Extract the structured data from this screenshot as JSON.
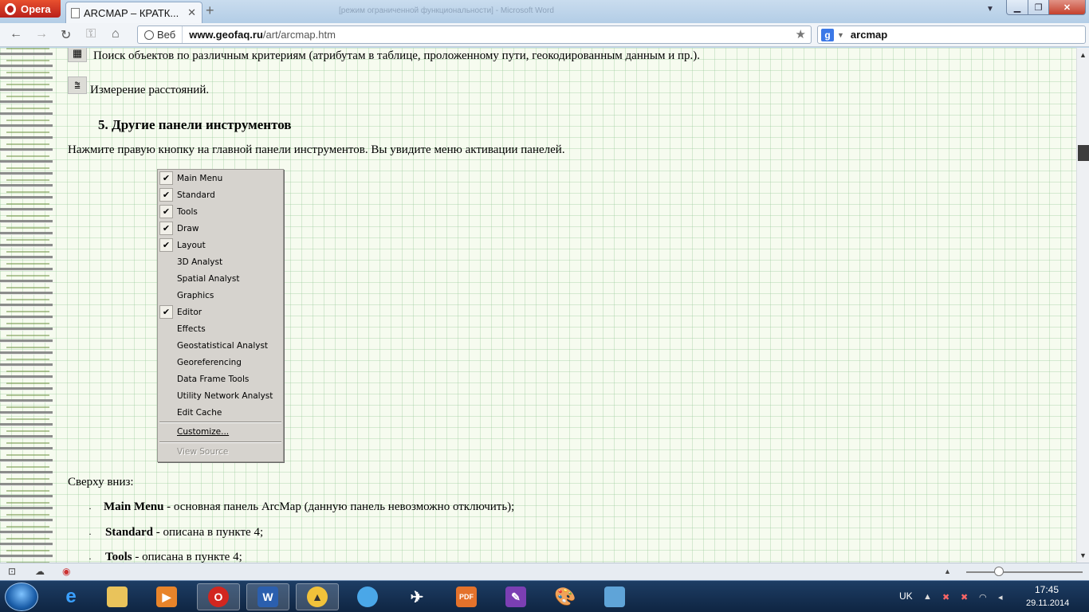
{
  "browser": {
    "opera_label": "Opera",
    "tab_title": "ARCMAP – КРАТК...",
    "blurred_window_title": "[режим ограниченной функциональности] - Microsoft Word",
    "address_badge": "Веб",
    "url_domain": "www.geofaq.ru",
    "url_path": "/art/arcmap.htm",
    "search_value": "arcmap"
  },
  "content": {
    "search_objects_text": "Поиск объектов по различным критериям (атрибутам в таблице, проложенному пути, геокодированным данным и пр.).",
    "measure_text": "Измерение расстояний.",
    "section_heading": "5. Другие панели инструментов",
    "intro_text": "Нажмите правую кнопку на главной панели инструментов. Вы увидите меню активации панелей.",
    "top_down_label": "Сверху вниз:",
    "bullets": [
      {
        "bold": "Main Menu",
        "rest": " - основная панель ArcMap (данную панель невозможно отключить);"
      },
      {
        "bold": "Standard",
        "rest": " - описана в пункте 4;"
      },
      {
        "bold": "Tools",
        "rest": " - описана в пункте 4;"
      }
    ]
  },
  "menu": {
    "items": [
      {
        "label": "Main Menu",
        "checked": true
      },
      {
        "label": "Standard",
        "checked": true
      },
      {
        "label": "Tools",
        "checked": true
      },
      {
        "label": "Draw",
        "checked": true
      },
      {
        "label": "Layout",
        "checked": true
      },
      {
        "label": "3D Analyst",
        "checked": false
      },
      {
        "label": "Spatial Analyst",
        "checked": false
      },
      {
        "label": "Graphics",
        "checked": false
      },
      {
        "label": "Editor",
        "checked": true
      },
      {
        "label": "Effects",
        "checked": false
      },
      {
        "label": "Geostatistical Analyst",
        "checked": false
      },
      {
        "label": "Georeferencing",
        "checked": false
      },
      {
        "label": "Data Frame Tools",
        "checked": false
      },
      {
        "label": "Utility Network Analyst",
        "checked": false
      },
      {
        "label": "Edit Cache",
        "checked": false
      }
    ],
    "customize": "Customize...",
    "view_source": "View Source"
  },
  "taskbar": {
    "lang": "UK",
    "time": "17:45",
    "date": "29.11.2014"
  }
}
